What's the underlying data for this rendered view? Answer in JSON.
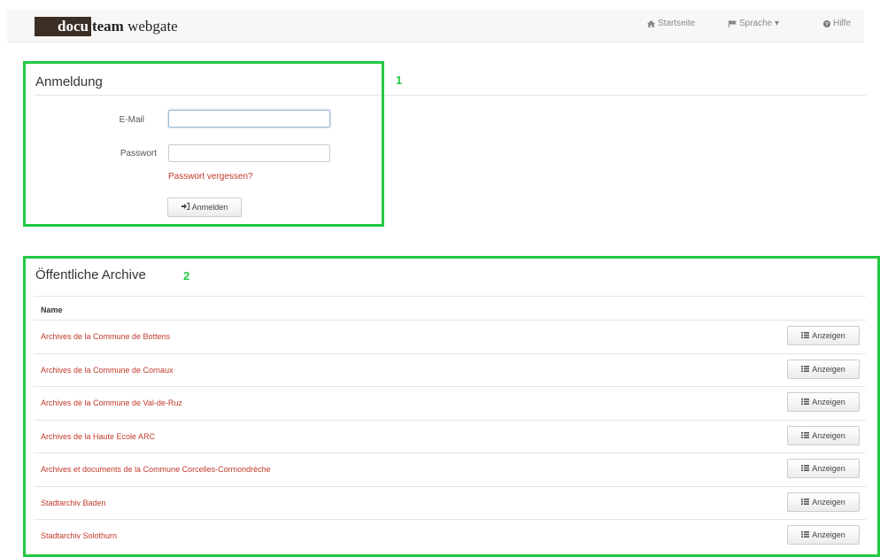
{
  "header": {
    "brand_dark": "docu",
    "brand_bold": "team",
    "brand_rest": " webgate",
    "nav": [
      {
        "label": "Startseite",
        "icon": "home-icon"
      },
      {
        "label": "Sprache ▾",
        "icon": "flag-icon"
      },
      {
        "label": "Hilfe",
        "icon": "question-circle-icon"
      }
    ]
  },
  "annotations": {
    "login": "1",
    "archives": "2",
    "color": "#22c943"
  },
  "login": {
    "title": "Anmeldung",
    "email_label": "E-Mail",
    "email_value": "",
    "password_label": "Passwort",
    "password_value": "",
    "forgot_link": "Passwort vergessen?",
    "submit_label": "Anmelden"
  },
  "archives": {
    "title": "Öffentliche Archive",
    "column_name": "Name",
    "show_label": "Anzeigen",
    "rows": [
      "Archives de la Commune de Bottens",
      "Archives de la Commune de Cornaux",
      "Archives de la Commune de Val-de-Ruz",
      "Archives de la Haute Ecole ARC",
      "Archives et documents de la Commune Corcelles-Cormondrèche",
      "Stadtarchiv Baden",
      "Stadtarchiv Solothurn"
    ]
  },
  "colors": {
    "link": "#c0392b",
    "brand_bg": "#3b2f25"
  }
}
